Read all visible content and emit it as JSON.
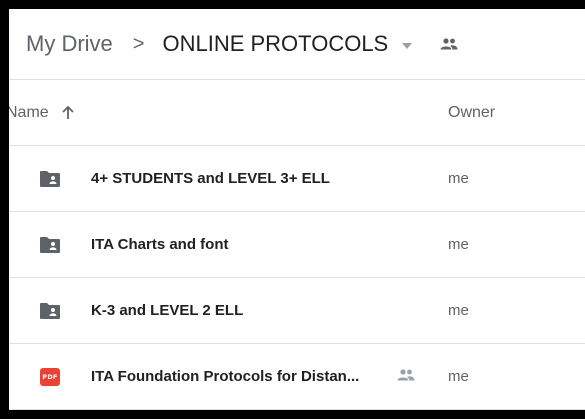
{
  "breadcrumb": {
    "root": "My Drive",
    "separator": ">",
    "current": "ONLINE PROTOCOLS",
    "dropdown_icon": "caret-down-icon",
    "shared_icon": "people-icon"
  },
  "columns": {
    "name": "Name",
    "sort_icon": "arrow-up-icon",
    "owner": "Owner"
  },
  "files": [
    {
      "name": "4+ STUDENTS and LEVEL 3+ ELL",
      "type": "shared-folder",
      "owner": "me"
    },
    {
      "name": "ITA Charts and font",
      "type": "shared-folder",
      "owner": "me"
    },
    {
      "name": "K-3 and LEVEL 2 ELL",
      "type": "shared-folder",
      "owner": "me"
    },
    {
      "name": "ITA Foundation Protocols for Distan...",
      "type": "pdf",
      "badge": "PDF",
      "shared": true,
      "owner": "me"
    }
  ],
  "colors": {
    "folder_icon": "#5f6368",
    "pdf_red": "#ea4335",
    "divider": "#e0e0e0",
    "text_primary": "#202124",
    "text_secondary": "#5f6368"
  }
}
